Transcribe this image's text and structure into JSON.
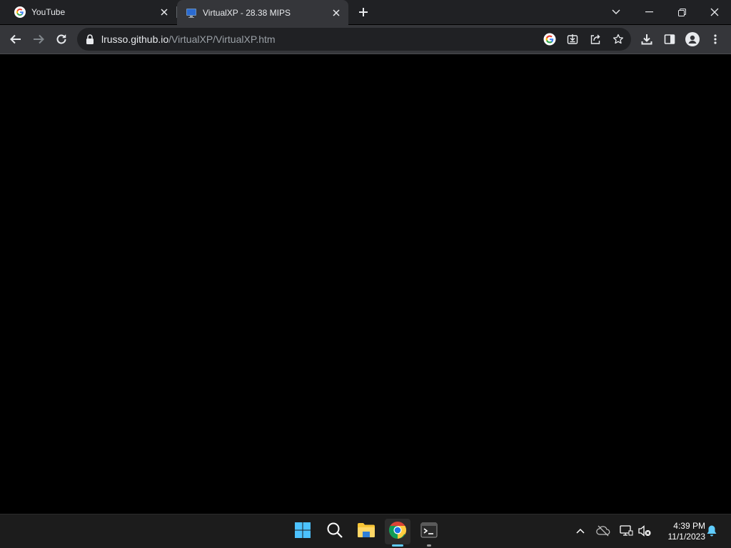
{
  "tabs": [
    {
      "title": "YouTube",
      "active": false
    },
    {
      "title": "VirtualXP - 28.38 MIPS",
      "active": true
    }
  ],
  "address_bar": {
    "host": "lrusso.github.io",
    "path": "/VirtualXP/VirtualXP.htm"
  },
  "clock": {
    "time": "4:39 PM",
    "date": "11/1/2023"
  },
  "colors": {
    "titlebar": "#202124",
    "toolbar": "#35363a",
    "omnibox": "#202124",
    "content": "#000000",
    "taskbar": "#1c1c1c",
    "accent": "#60cdff"
  },
  "taskbar_apps": [
    "start-icon",
    "search-icon",
    "file-explorer-icon",
    "chrome-icon",
    "terminal-icon"
  ]
}
